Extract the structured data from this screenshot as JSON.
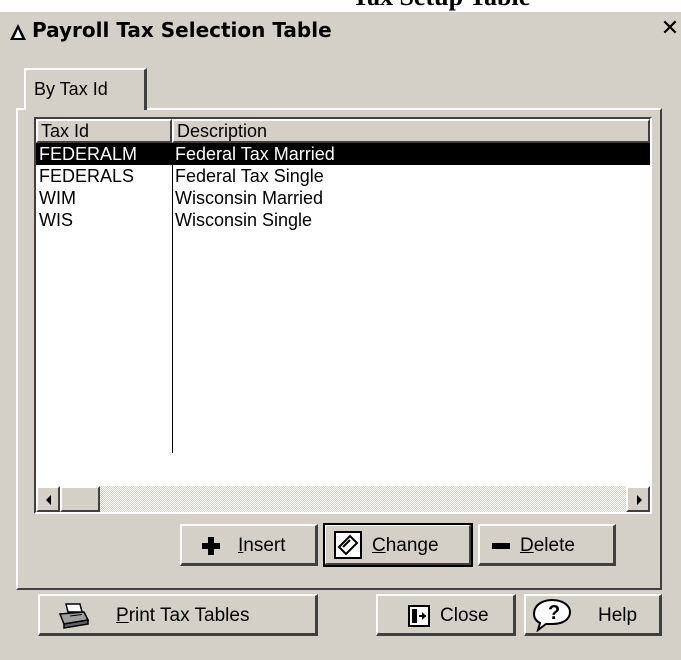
{
  "top_fragment": "Tax Setup Table",
  "window": {
    "title": "Payroll Tax Selection Table",
    "close_glyph": "✕"
  },
  "tabs": [
    {
      "label": "By Tax Id",
      "selected": true
    }
  ],
  "table": {
    "columns": [
      "Tax Id",
      "Description"
    ],
    "rows": [
      {
        "tax_id": "FEDERALM",
        "description": "Federal Tax Married",
        "selected": true
      },
      {
        "tax_id": "FEDERALS",
        "description": "Federal Tax Single",
        "selected": false
      },
      {
        "tax_id": "WIM",
        "description": "Wisconsin Married",
        "selected": false
      },
      {
        "tax_id": "WIS",
        "description": "Wisconsin Single",
        "selected": false
      }
    ]
  },
  "buttons": {
    "insert": {
      "label": "Insert",
      "mnemonic": "I",
      "rest": "nsert",
      "icon": "plus-icon"
    },
    "change": {
      "label": "Change",
      "mnemonic": "C",
      "rest": "hange",
      "icon": "edit-icon"
    },
    "delete": {
      "label": "Delete",
      "mnemonic": "D",
      "rest": "elete",
      "icon": "minus-icon"
    },
    "print": {
      "label": "Print Tax Tables",
      "mnemonic": "P",
      "rest": "rint Tax Tables",
      "icon": "printer-icon"
    },
    "close": {
      "label": "Close",
      "icon": "exit-door-icon"
    },
    "help": {
      "label": "Help",
      "icon": "help-question-icon"
    }
  },
  "colors": {
    "face": "#d4d0c8",
    "selection": "#000000"
  }
}
